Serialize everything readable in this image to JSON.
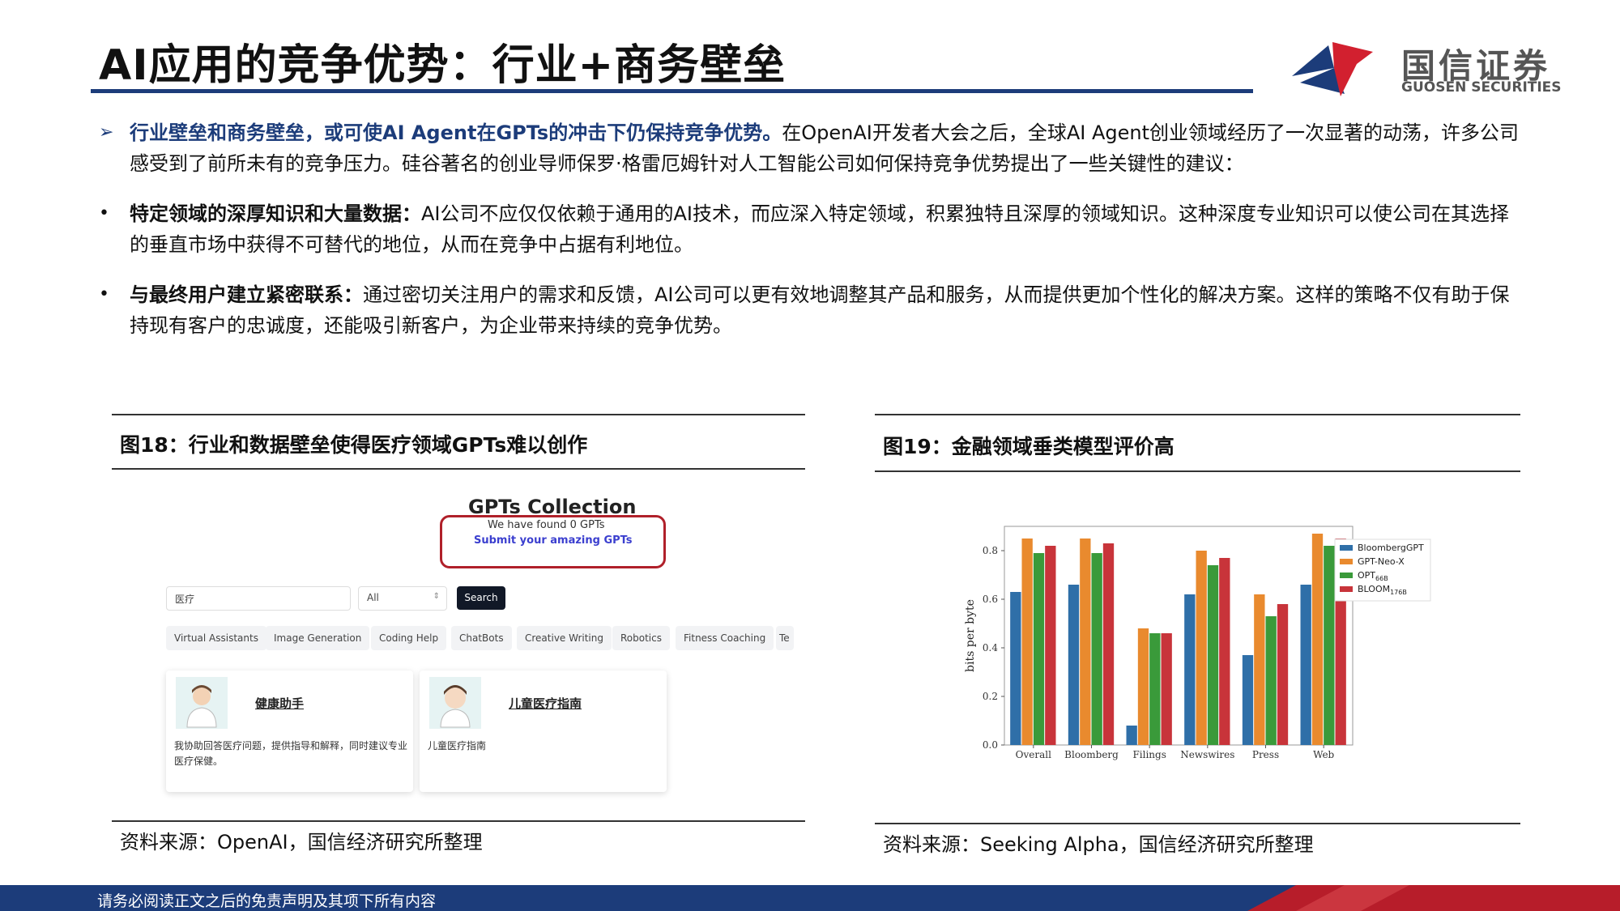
{
  "title": "AI应用的竞争优势：行业+商务壁垒",
  "logo": {
    "cn": "国信证券",
    "en": "GUOSEN SECURITIES"
  },
  "paragraphs": {
    "p1": {
      "marker": "➢",
      "lead": "行业壁垒和商务壁垒，或可使AI Agent在GPTs的冲击下仍保持竞争优势。",
      "body": "在OpenAI开发者大会之后，全球AI Agent创业领域经历了一次显著的动荡，许多公司感受到了前所未有的竞争压力。硅谷著名的创业导师保罗·格雷厄姆针对人工智能公司如何保持竞争优势提出了一些关键性的建议："
    },
    "p2": {
      "marker": "•",
      "lead": "特定领域的深厚知识和大量数据：",
      "body": "AI公司不应仅仅依赖于通用的AI技术，而应深入特定领域，积累独特且深厚的领域知识。这种深度专业知识可以使公司在其选择的垂直市场中获得不可替代的地位，从而在竞争中占据有利地位。"
    },
    "p3": {
      "marker": "•",
      "lead": "与最终用户建立紧密联系：",
      "body": "通过密切关注用户的需求和反馈，AI公司可以更有效地调整其产品和服务，从而提供更加个性化的解决方案。这样的策略不仅有助于保持现有客户的忠诚度，还能吸引新客户，为企业带来持续的竞争优势。"
    }
  },
  "figure18": {
    "title": "图18：行业和数据壁垒使得医疗领域GPTs难以创作",
    "source": "资料来源：OpenAI，国信经济研究所整理",
    "screenshot": {
      "heading": "GPTs Collection",
      "found": "We have found 0 GPTs",
      "submit": "Submit your amazing GPTs",
      "search_value": "医疗",
      "category_value": "All",
      "search_button": "Search",
      "chips": [
        "Virtual Assistants",
        "Image Generation",
        "Coding Help",
        "ChatBots",
        "Creative Writing",
        "Robotics",
        "Fitness Coaching",
        "Te"
      ],
      "cards": [
        {
          "name": "健康助手",
          "desc": "我协助回答医疗问题，提供指导和解释，同时建议专业医疗保健。"
        },
        {
          "name": "儿童医疗指南",
          "desc": "儿童医疗指南"
        }
      ]
    }
  },
  "figure19": {
    "title": "图19：金融领域垂类模型评价高",
    "source": "资料来源：Seeking Alpha，国信经济研究所整理"
  },
  "chart_data": {
    "type": "bar",
    "categories": [
      "Overall",
      "Bloomberg",
      "Filings",
      "Newswires",
      "Press",
      "Web"
    ],
    "ylabel": "bits per byte",
    "ylim": [
      0,
      0.9
    ],
    "yticks": [
      "0.0",
      "0.2",
      "0.4",
      "0.6",
      "0.8"
    ],
    "legend_position": "top-right",
    "series": [
      {
        "name": "BloombergGPT",
        "color": "#2f6fa8",
        "values": [
          0.63,
          0.66,
          0.08,
          0.62,
          0.37,
          0.66
        ]
      },
      {
        "name": "GPT-Neo-X",
        "color": "#e98a2e",
        "values": [
          0.85,
          0.85,
          0.48,
          0.8,
          0.62,
          0.87
        ]
      },
      {
        "name": "OPT",
        "sub": "66B",
        "color": "#3a9a3a",
        "values": [
          0.79,
          0.79,
          0.46,
          0.74,
          0.53,
          0.82
        ]
      },
      {
        "name": "BLOOM",
        "sub": "176B",
        "color": "#c8343a",
        "values": [
          0.82,
          0.83,
          0.46,
          0.77,
          0.58,
          0.85
        ]
      }
    ]
  },
  "footer": {
    "disclaimer": "请务必阅读正文之后的免责声明及其项下所有内容"
  },
  "colors": {
    "brand_blue": "#1c3c7a",
    "brand_red": "#c8202a"
  }
}
